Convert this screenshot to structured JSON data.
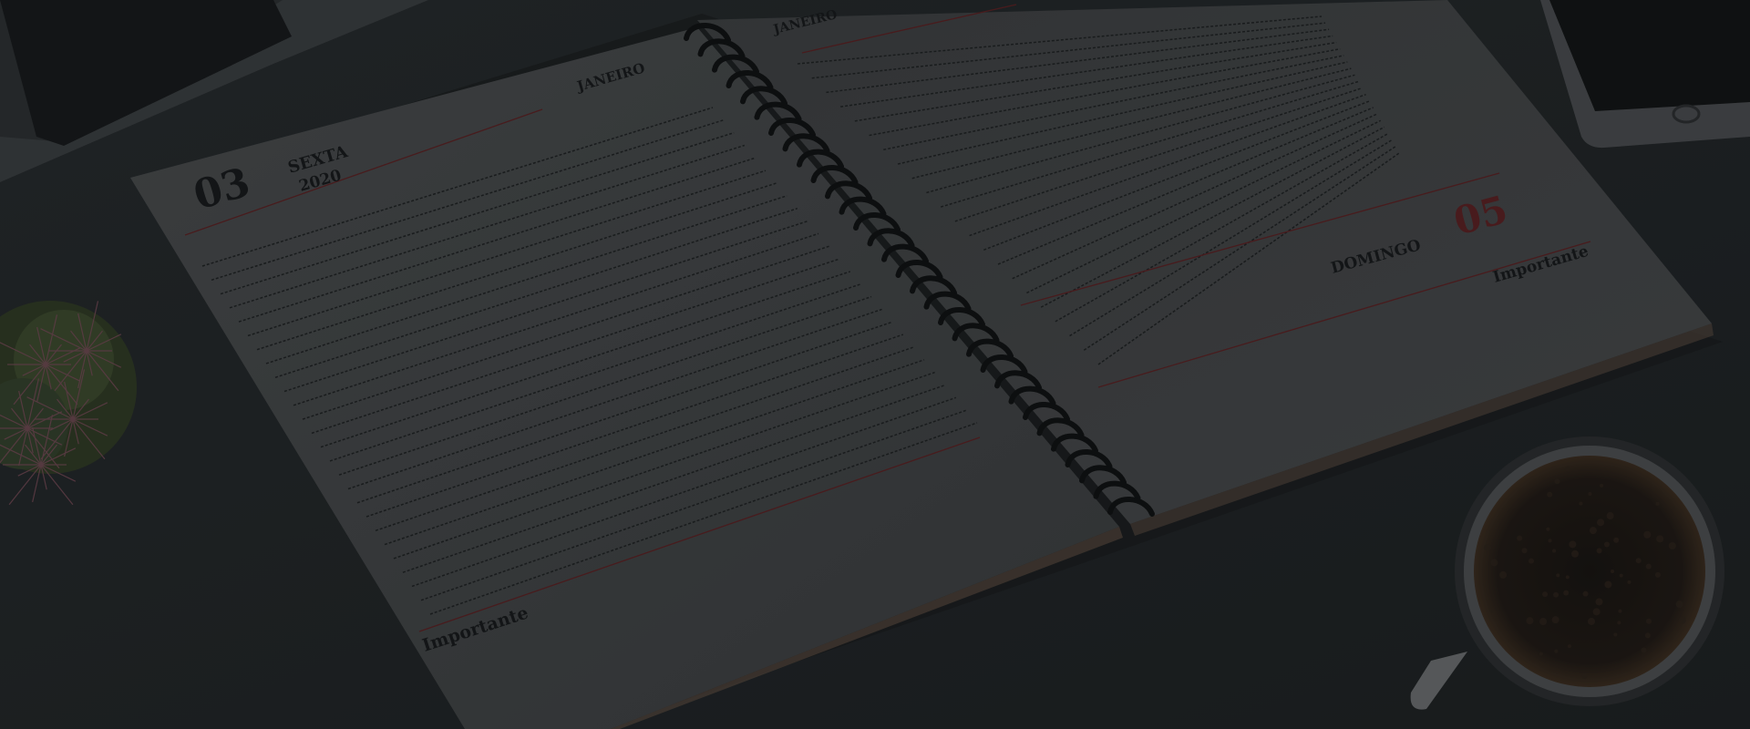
{
  "planner": {
    "left_page": {
      "day_number": "03",
      "weekday": "SEXTA",
      "year": "2020",
      "month": "JANEIRO",
      "notes_label": "Importante"
    },
    "right_page": {
      "day_number": "05",
      "weekday": "DOMINGO",
      "month": "JANEIRO",
      "notes_label": "Importante"
    }
  },
  "colors": {
    "desk": "#1f2326",
    "page": "#434547",
    "accent_red": "#5e1e20",
    "spiral": "#0c0d0e"
  },
  "objects": [
    "laptop",
    "spiral-planner",
    "cactus-plant",
    "smartphone",
    "coffee-cup"
  ]
}
